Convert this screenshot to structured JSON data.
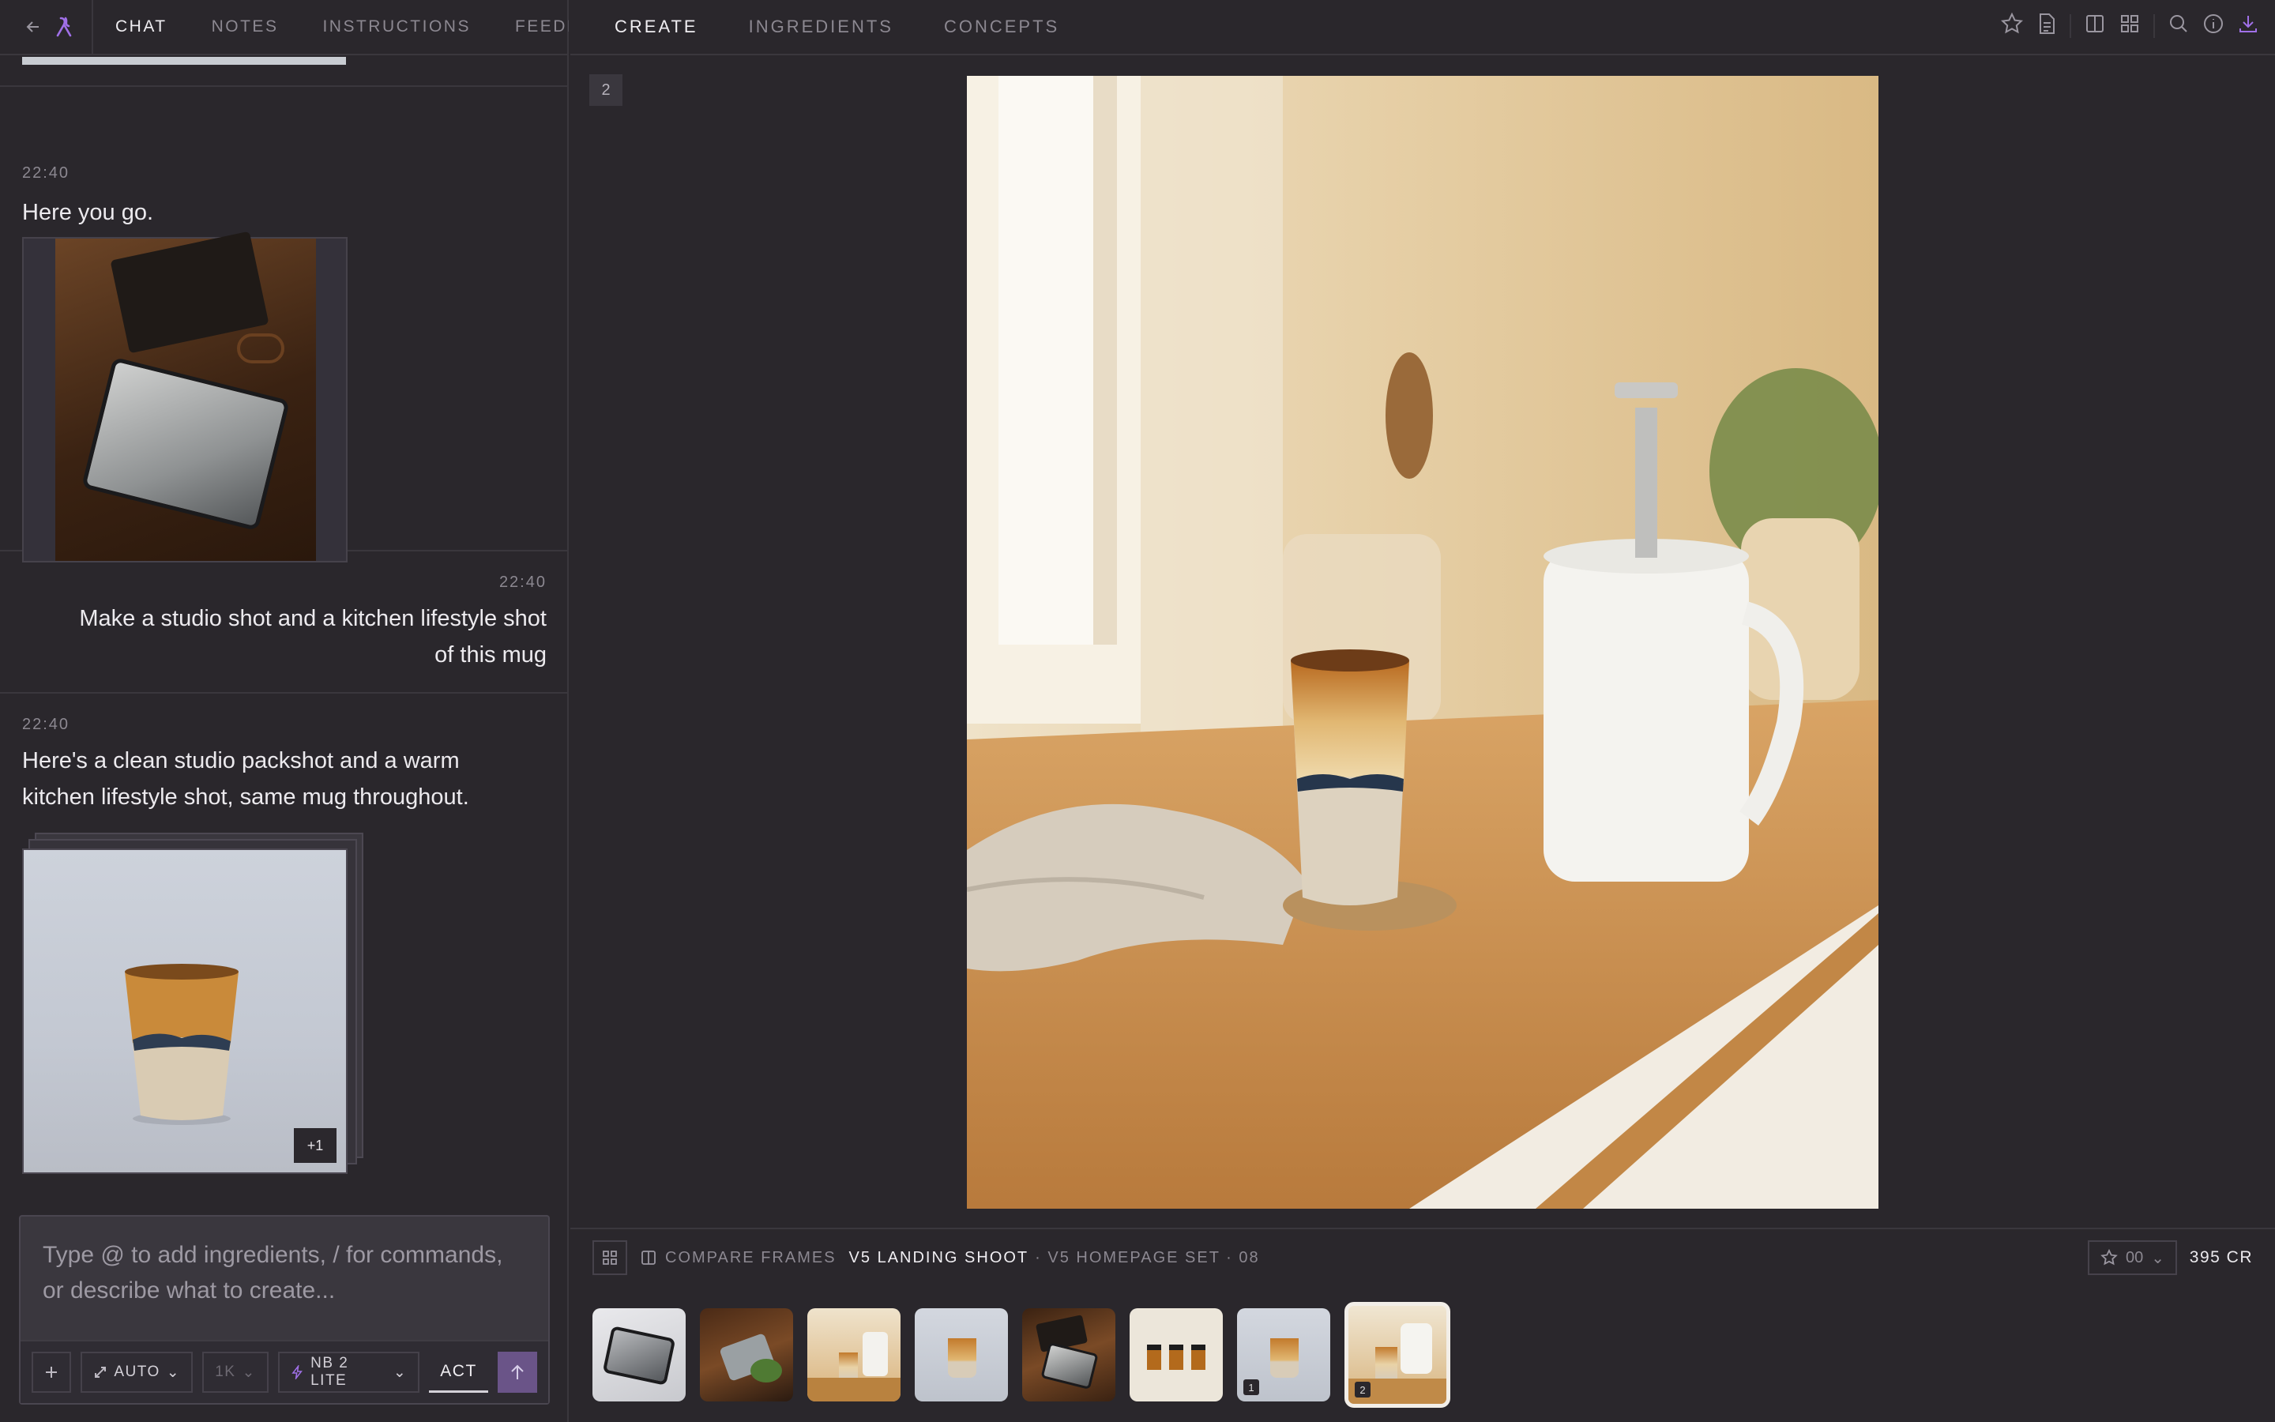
{
  "nav": {
    "tabs_left": [
      "CHAT",
      "NOTES",
      "INSTRUCTIONS",
      "FEEDBA"
    ],
    "tabs_right": [
      "CREATE",
      "INGREDIENTS",
      "CONCEPTS"
    ],
    "icons": [
      "star-icon",
      "document-icon",
      "split-view-icon",
      "grid-icon",
      "search-icon",
      "info-icon",
      "download-icon"
    ]
  },
  "chat": {
    "messages": [
      {
        "time": "22:40",
        "text": "Here you go.",
        "role": "assistant"
      },
      {
        "time": "22:40",
        "text": "Make a studio shot and a kitchen lifestyle shot of this mug",
        "role": "user"
      },
      {
        "time": "22:40",
        "text": "Here's a clean studio packshot and a warm kitchen lifestyle shot, same mug throughout.",
        "role": "assistant",
        "stack_badge": "+1"
      }
    ]
  },
  "composer": {
    "placeholder": "Type @ to add ingredients, / for commands, or describe what to create...",
    "aspect": "AUTO",
    "resolution": "1K",
    "model": "NB 2 LITE",
    "mode": "ACT"
  },
  "canvas": {
    "frame_number": "2"
  },
  "bottom": {
    "compare_label": "COMPARE FRAMES",
    "shoot_name": "V5 LANDING SHOOT",
    "set_info": "· V5 HOMEPAGE SET · 08",
    "rating": "00",
    "credits": "395 CR",
    "thumb_badges": [
      "1",
      "2"
    ]
  }
}
